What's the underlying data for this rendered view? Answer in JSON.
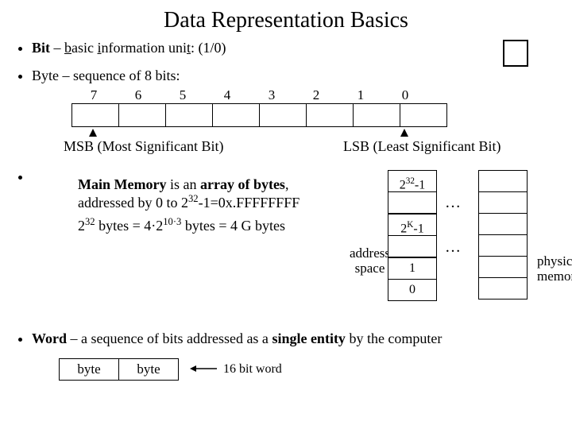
{
  "title": "Data Representation Basics",
  "bit": {
    "label_bold": "Bit",
    "sep": " – ",
    "uB": "b",
    "t1": "asic ",
    "uI": "i",
    "t2": "nformation uni",
    "uT": "t",
    "suffix": ": (1/0)"
  },
  "byte": {
    "lead": "Byte – sequence of 8 bits:",
    "nums": [
      "7",
      "6",
      "5",
      "4",
      "3",
      "2",
      "1",
      "0"
    ],
    "msb": "MSB (Most Significant Bit)",
    "lsb": "LSB (Least Significant Bit)"
  },
  "memory": {
    "lead_b": "Main Memory",
    "lead_mid": " is an ",
    "lead_b2": "array of bytes",
    "lead_tail": ", addressed by 0 to 2",
    "exp1": "32",
    "lead_tail2": "-1=0x.FFFFFFFF",
    "line2a": "2",
    "line2b": "32",
    "line2c": " bytes = 4·2",
    "line2d": "10·3",
    "line2e": " bytes = 4 G bytes",
    "addr_top_a": "2",
    "addr_top_b": "32",
    "addr_top_c": "-1",
    "addr_mid_a": "2",
    "addr_mid_b": "K",
    "addr_mid_c": "-1",
    "addr_1": "1",
    "addr_0": "0",
    "dots": "…",
    "addr_space": "address\nspace",
    "phys_note": "physical\nmemory"
  },
  "word": {
    "lead1_b": "Word",
    "lead1_t": " – a sequence of bits addressed as a ",
    "lead1_b2": "single entity",
    "lead1_t2": " by the computer",
    "byte_label": "byte",
    "word16": "16 bit word"
  }
}
